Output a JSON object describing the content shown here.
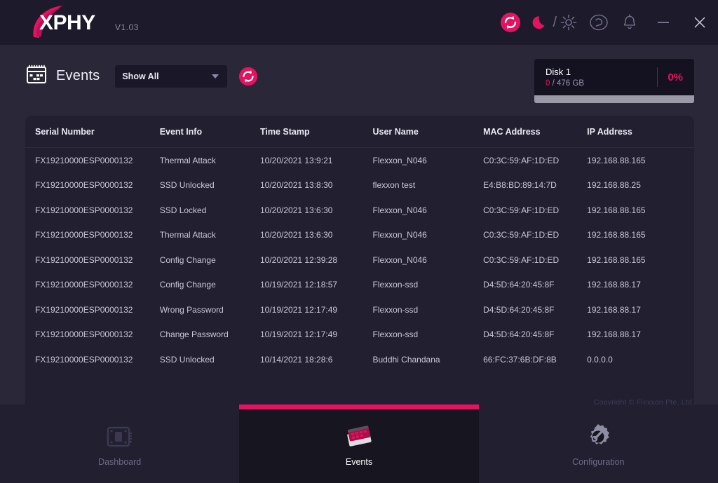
{
  "app": {
    "brand_text": "PHY",
    "brand_prefix": "X",
    "version": "V1.03",
    "accent_color": "#e5135f",
    "background_color": "#2a2738",
    "panel_color": "#211f30",
    "titlebar_color": "#1c1a2b"
  },
  "titlebar": {
    "icons": [
      {
        "name": "sync-icon",
        "label": "Sync"
      },
      {
        "name": "moon-icon",
        "label": "Dark theme"
      },
      {
        "name": "theme-separator",
        "label": "/"
      },
      {
        "name": "sun-icon",
        "label": "Light theme"
      },
      {
        "name": "support-icon",
        "label": "Support"
      },
      {
        "name": "bell-icon",
        "label": "Notifications"
      },
      {
        "name": "minimize-icon",
        "label": "Minimize"
      },
      {
        "name": "close-icon",
        "label": "Close"
      }
    ]
  },
  "toolbar": {
    "title": "Events",
    "calendar_icon": "calendar-icon",
    "filter": {
      "selected": "Show All",
      "options": [
        "Show All"
      ]
    },
    "refresh_icon": "refresh-icon"
  },
  "disk": {
    "name": "Disk 1",
    "used": "0",
    "separator": "/",
    "capacity": "476 GB",
    "percent_label": "0%",
    "percent_value": 0
  },
  "table": {
    "columns": [
      "Serial Number",
      "Event Info",
      "Time Stamp",
      "User Name",
      "MAC Address",
      "IP Address"
    ],
    "rows": [
      [
        "FX19210000ESP0000132",
        "Thermal Attack",
        "10/20/2021 13:9:21",
        "Flexxon_N046",
        "C0:3C:59:AF:1D:ED",
        "192.168.88.165"
      ],
      [
        "FX19210000ESP0000132",
        "SSD Unlocked",
        "10/20/2021 13:8:30",
        "flexxon test",
        "E4:B8:BD:89:14:7D",
        "192.168.88.25"
      ],
      [
        "FX19210000ESP0000132",
        "SSD Locked",
        "10/20/2021 13:6:30",
        "Flexxon_N046",
        "C0:3C:59:AF:1D:ED",
        "192.168.88.165"
      ],
      [
        "FX19210000ESP0000132",
        "Thermal Attack",
        "10/20/2021 13:6:30",
        "Flexxon_N046",
        "C0:3C:59:AF:1D:ED",
        "192.168.88.165"
      ],
      [
        "FX19210000ESP0000132",
        "Config Change",
        "10/20/2021 12:39:28",
        "Flexxon_N046",
        "C0:3C:59:AF:1D:ED",
        "192.168.88.165"
      ],
      [
        "FX19210000ESP0000132",
        "Config Change",
        "10/19/2021 12:18:57",
        "Flexxon-ssd",
        "D4:5D:64:20:45:8F",
        "192.168.88.17"
      ],
      [
        "FX19210000ESP0000132",
        "Wrong Password",
        "10/19/2021 12:17:49",
        "Flexxon-ssd",
        "D4:5D:64:20:45:8F",
        "192.168.88.17"
      ],
      [
        "FX19210000ESP0000132",
        "Change Password",
        "10/19/2021 12:17:49",
        "Flexxon-ssd",
        "D4:5D:64:20:45:8F",
        "192.168.88.17"
      ],
      [
        "FX19210000ESP0000132",
        "SSD Unlocked",
        "10/14/2021 18:28:6",
        "Buddhi Chandana",
        "66:FC:37:6B:DF:8B",
        "0.0.0.0"
      ]
    ]
  },
  "footer": {
    "copyright": "Copyright © Flexxon Pte. Ltd."
  },
  "bottom_nav": {
    "items": [
      {
        "label": "Dashboard",
        "icon": "ssd-drive-icon",
        "active": false
      },
      {
        "label": "Events",
        "icon": "calendar-3d-icon",
        "active": true
      },
      {
        "label": "Configuration",
        "icon": "gear-wrench-icon",
        "active": false
      }
    ]
  }
}
